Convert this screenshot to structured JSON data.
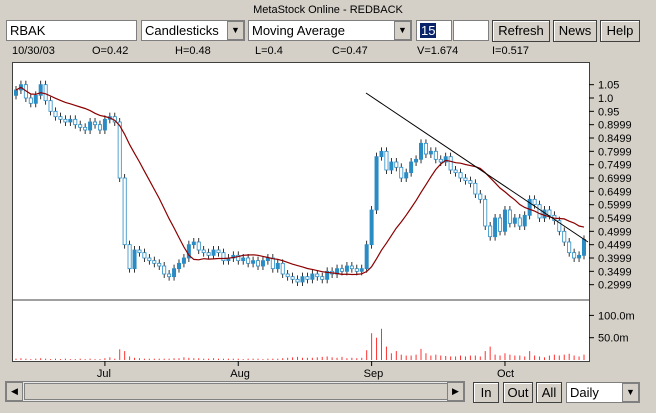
{
  "window": {
    "title": "MetaStock Online - REDBACK"
  },
  "toolbar": {
    "symbol": "RBAK",
    "chart_style": "Candlesticks",
    "indicator": "Moving Average",
    "period": "15",
    "extra": "",
    "refresh_label": "Refresh",
    "news_label": "News",
    "help_label": "Help"
  },
  "infobar": {
    "date": "10/30/03",
    "open": "O=0.42",
    "high": "H=0.48",
    "low": "L=0.4",
    "close": "C=0.47",
    "volume": "V=1.674",
    "interest": "I=0.517"
  },
  "bottom": {
    "in_label": "In",
    "out_label": "Out",
    "all_label": "All",
    "timeframe": "Daily"
  },
  "colors": {
    "up": "#2b8cc4",
    "ma": "#8b0000",
    "trend": "#000000",
    "volume": "#ff3030"
  },
  "chart_data": {
    "type": "candlestick",
    "title": "",
    "price_ticks": [
      "1.05",
      "1.0",
      "0.95",
      "0.8999",
      "0.8499",
      "0.7999",
      "0.7499",
      "0.6999",
      "0.6499",
      "0.5999",
      "0.5499",
      "0.4999",
      "0.4499",
      "0.3999",
      "0.3499",
      "0.2999"
    ],
    "price_tick_values": [
      1.05,
      1.0,
      0.95,
      0.9,
      0.85,
      0.8,
      0.75,
      0.7,
      0.65,
      0.6,
      0.55,
      0.5,
      0.45,
      0.4,
      0.35,
      0.3
    ],
    "ylim": [
      0.25,
      1.12
    ],
    "volume_ticks": [
      "100.0m",
      "50.0m"
    ],
    "volume_tick_values": [
      100,
      50
    ],
    "volume_ylim": [
      0,
      130
    ],
    "months": [
      {
        "label": "Jul",
        "index": 18
      },
      {
        "label": "Aug",
        "index": 45
      },
      {
        "label": "Sep",
        "index": 72
      },
      {
        "label": "Oct",
        "index": 99
      }
    ],
    "close": [
      1.03,
      1.05,
      1.0,
      0.98,
      1.01,
      1.05,
      0.99,
      0.95,
      0.93,
      0.92,
      0.91,
      0.92,
      0.9,
      0.89,
      0.88,
      0.91,
      0.9,
      0.88,
      0.92,
      0.93,
      0.91,
      0.7,
      0.45,
      0.36,
      0.43,
      0.42,
      0.4,
      0.39,
      0.38,
      0.37,
      0.34,
      0.33,
      0.36,
      0.38,
      0.4,
      0.45,
      0.46,
      0.43,
      0.42,
      0.41,
      0.43,
      0.42,
      0.39,
      0.4,
      0.41,
      0.39,
      0.4,
      0.38,
      0.39,
      0.37,
      0.39,
      0.4,
      0.36,
      0.38,
      0.34,
      0.33,
      0.32,
      0.31,
      0.33,
      0.32,
      0.34,
      0.33,
      0.32,
      0.35,
      0.34,
      0.36,
      0.35,
      0.37,
      0.36,
      0.35,
      0.36,
      0.45,
      0.58,
      0.78,
      0.8,
      0.73,
      0.76,
      0.74,
      0.7,
      0.72,
      0.76,
      0.77,
      0.83,
      0.79,
      0.8,
      0.77,
      0.76,
      0.78,
      0.73,
      0.72,
      0.7,
      0.69,
      0.68,
      0.64,
      0.62,
      0.52,
      0.48,
      0.55,
      0.5,
      0.58,
      0.53,
      0.55,
      0.52,
      0.56,
      0.62,
      0.6,
      0.55,
      0.58,
      0.56,
      0.54,
      0.5,
      0.46,
      0.42,
      0.4,
      0.41,
      0.47
    ],
    "volume": [
      3,
      4,
      3,
      2,
      3,
      4,
      3,
      2,
      3,
      2,
      3,
      2,
      2,
      3,
      2,
      3,
      2,
      2,
      4,
      6,
      3,
      24,
      20,
      8,
      5,
      4,
      3,
      3,
      3,
      3,
      3,
      3,
      4,
      4,
      6,
      5,
      4,
      4,
      3,
      3,
      4,
      3,
      3,
      3,
      3,
      3,
      2,
      3,
      3,
      3,
      2,
      3,
      3,
      3,
      4,
      5,
      6,
      7,
      5,
      5,
      5,
      6,
      7,
      8,
      6,
      5,
      7,
      4,
      5,
      4,
      5,
      22,
      60,
      50,
      70,
      30,
      15,
      20,
      12,
      10,
      10,
      12,
      25,
      15,
      10,
      12,
      10,
      9,
      8,
      8,
      10,
      8,
      10,
      10,
      8,
      20,
      30,
      12,
      10,
      15,
      12,
      10,
      10,
      8,
      20,
      10,
      8,
      6,
      10,
      12,
      10,
      12,
      14,
      10,
      8,
      12
    ]
  }
}
